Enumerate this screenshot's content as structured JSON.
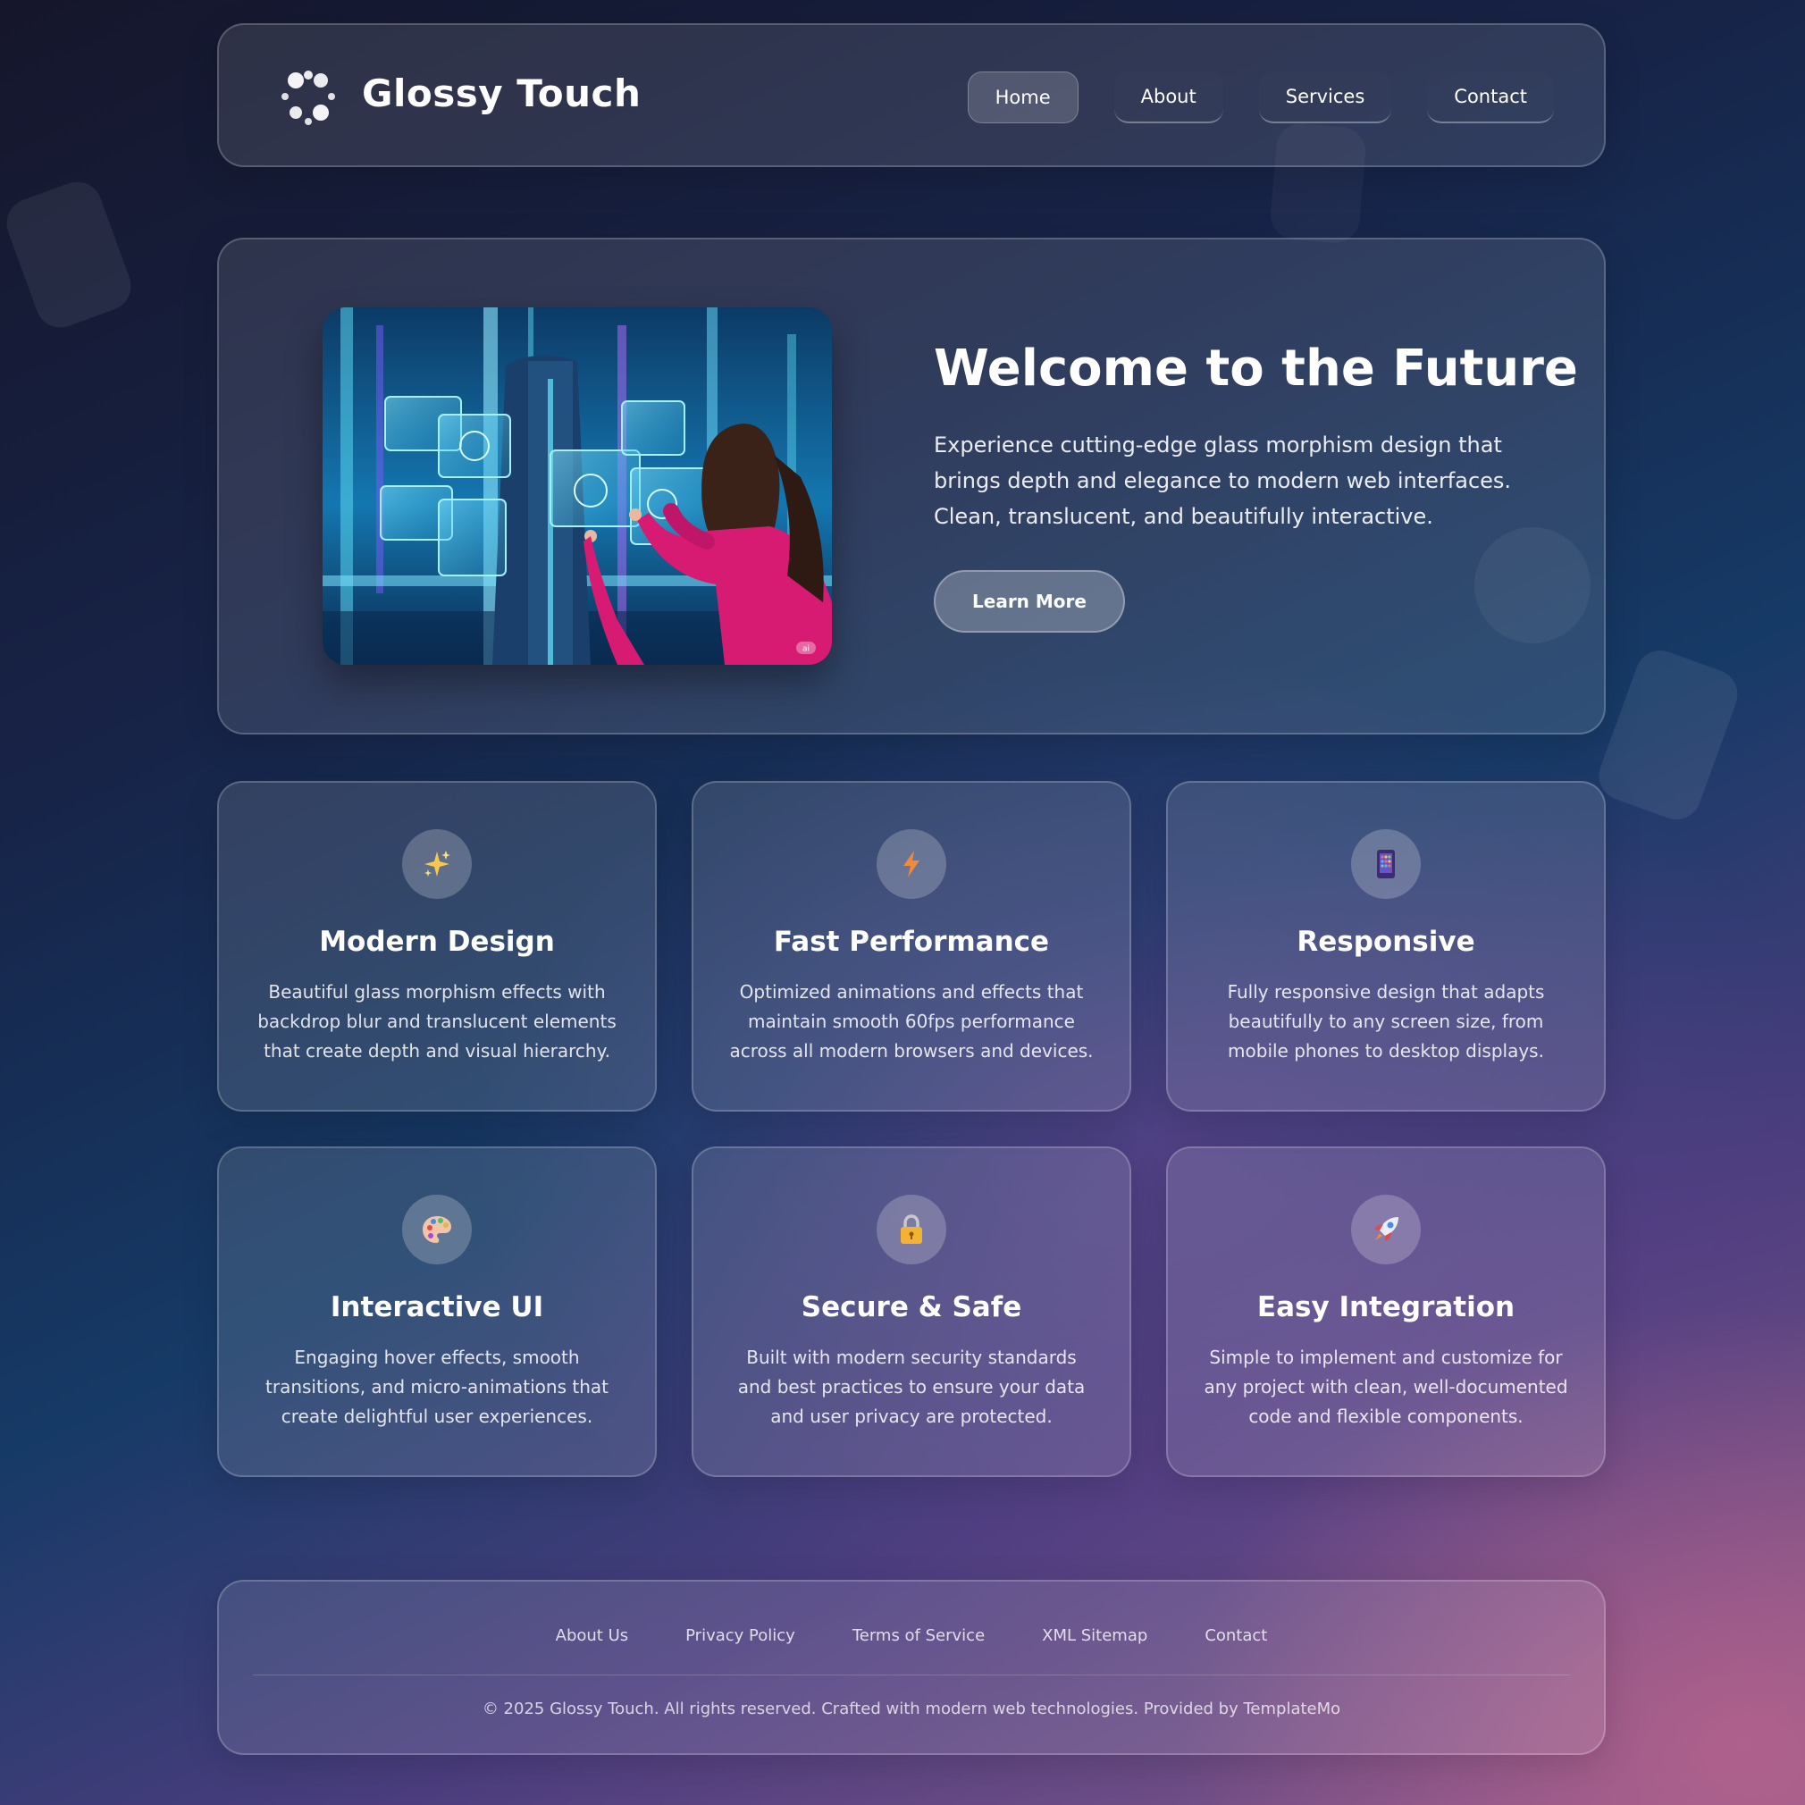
{
  "brand": {
    "name": "Glossy Touch"
  },
  "nav": {
    "items": [
      {
        "label": "Home",
        "active": true
      },
      {
        "label": "About",
        "active": false
      },
      {
        "label": "Services",
        "active": false
      },
      {
        "label": "Contact",
        "active": false
      }
    ]
  },
  "hero": {
    "title": "Welcome to the Future",
    "text": "Experience cutting-edge glass morphism design that brings depth and elegance to modern web interfaces. Clean, translucent, and beautifully interactive.",
    "button_label": "Learn More",
    "image_badge": "ai"
  },
  "features": [
    {
      "icon": "sparkles-icon",
      "title": "Modern Design",
      "text": "Beautiful glass morphism effects with backdrop blur and translucent elements that create depth and visual hierarchy."
    },
    {
      "icon": "lightning-icon",
      "title": "Fast Performance",
      "text": "Optimized animations and effects that maintain smooth 60fps performance across all modern browsers and devices."
    },
    {
      "icon": "mobile-phone-icon",
      "title": "Responsive",
      "text": "Fully responsive design that adapts beautifully to any screen size, from mobile phones to desktop displays."
    },
    {
      "icon": "palette-icon",
      "title": "Interactive UI",
      "text": "Engaging hover effects, smooth transitions, and micro-animations that create delightful user experiences."
    },
    {
      "icon": "lock-icon",
      "title": "Secure & Safe",
      "text": "Built with modern security standards and best practices to ensure your data and user privacy are protected."
    },
    {
      "icon": "rocket-icon",
      "title": "Easy Integration",
      "text": "Simple to implement and customize for any project with clean, well-documented code and flexible components."
    }
  ],
  "footer": {
    "links": [
      "About Us",
      "Privacy Policy",
      "Terms of Service",
      "XML Sitemap",
      "Contact"
    ],
    "copyright": "© 2025 Glossy Touch. All rights reserved. Crafted with modern web technologies. Provided by TemplateMo"
  },
  "colors": {
    "accent_pink": "#d81b72",
    "hologram_cyan": "#5ad7f0",
    "lightning_orange": "#f08a3c"
  }
}
